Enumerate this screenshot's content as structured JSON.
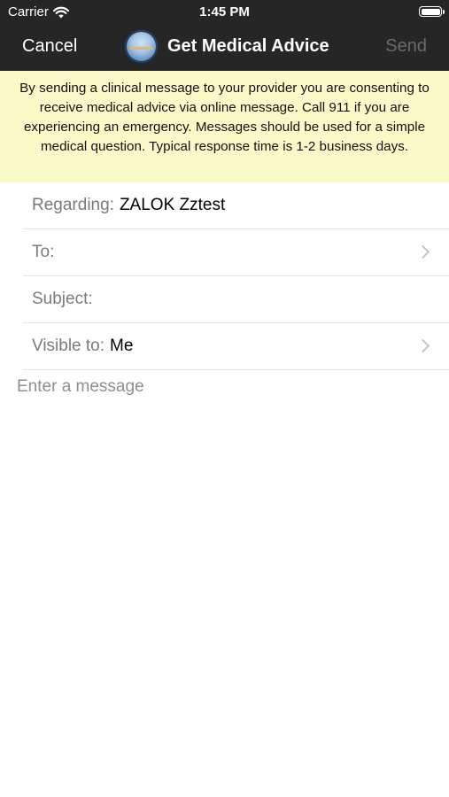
{
  "status_bar": {
    "carrier": "Carrier",
    "time": "1:45 PM",
    "icons": [
      "wifi-icon",
      "battery-icon"
    ]
  },
  "nav": {
    "cancel_label": "Cancel",
    "title": "Get Medical Advice",
    "send_label": "Send",
    "logo_icon": "app-logo-icon"
  },
  "banner": {
    "text": "By sending a clinical message to your provider you are consenting to receive medical advice via online message. Call 911 if you are experiencing an emergency. Messages should be used for a simple medical question. Typical response time is 1-2 business days."
  },
  "form": {
    "regarding": {
      "label": "Regarding:",
      "value": "ZALOK Zztest"
    },
    "to": {
      "label": "To:",
      "value": ""
    },
    "subject": {
      "label": "Subject:",
      "value": ""
    },
    "visible_to": {
      "label": "Visible to:",
      "value": "Me"
    }
  },
  "message": {
    "placeholder": "Enter a message"
  },
  "colors": {
    "nav_background": "#262626",
    "banner_background": "#fafac8",
    "send_disabled": "#6a6a6a",
    "label_gray": "#7a7a7e"
  }
}
